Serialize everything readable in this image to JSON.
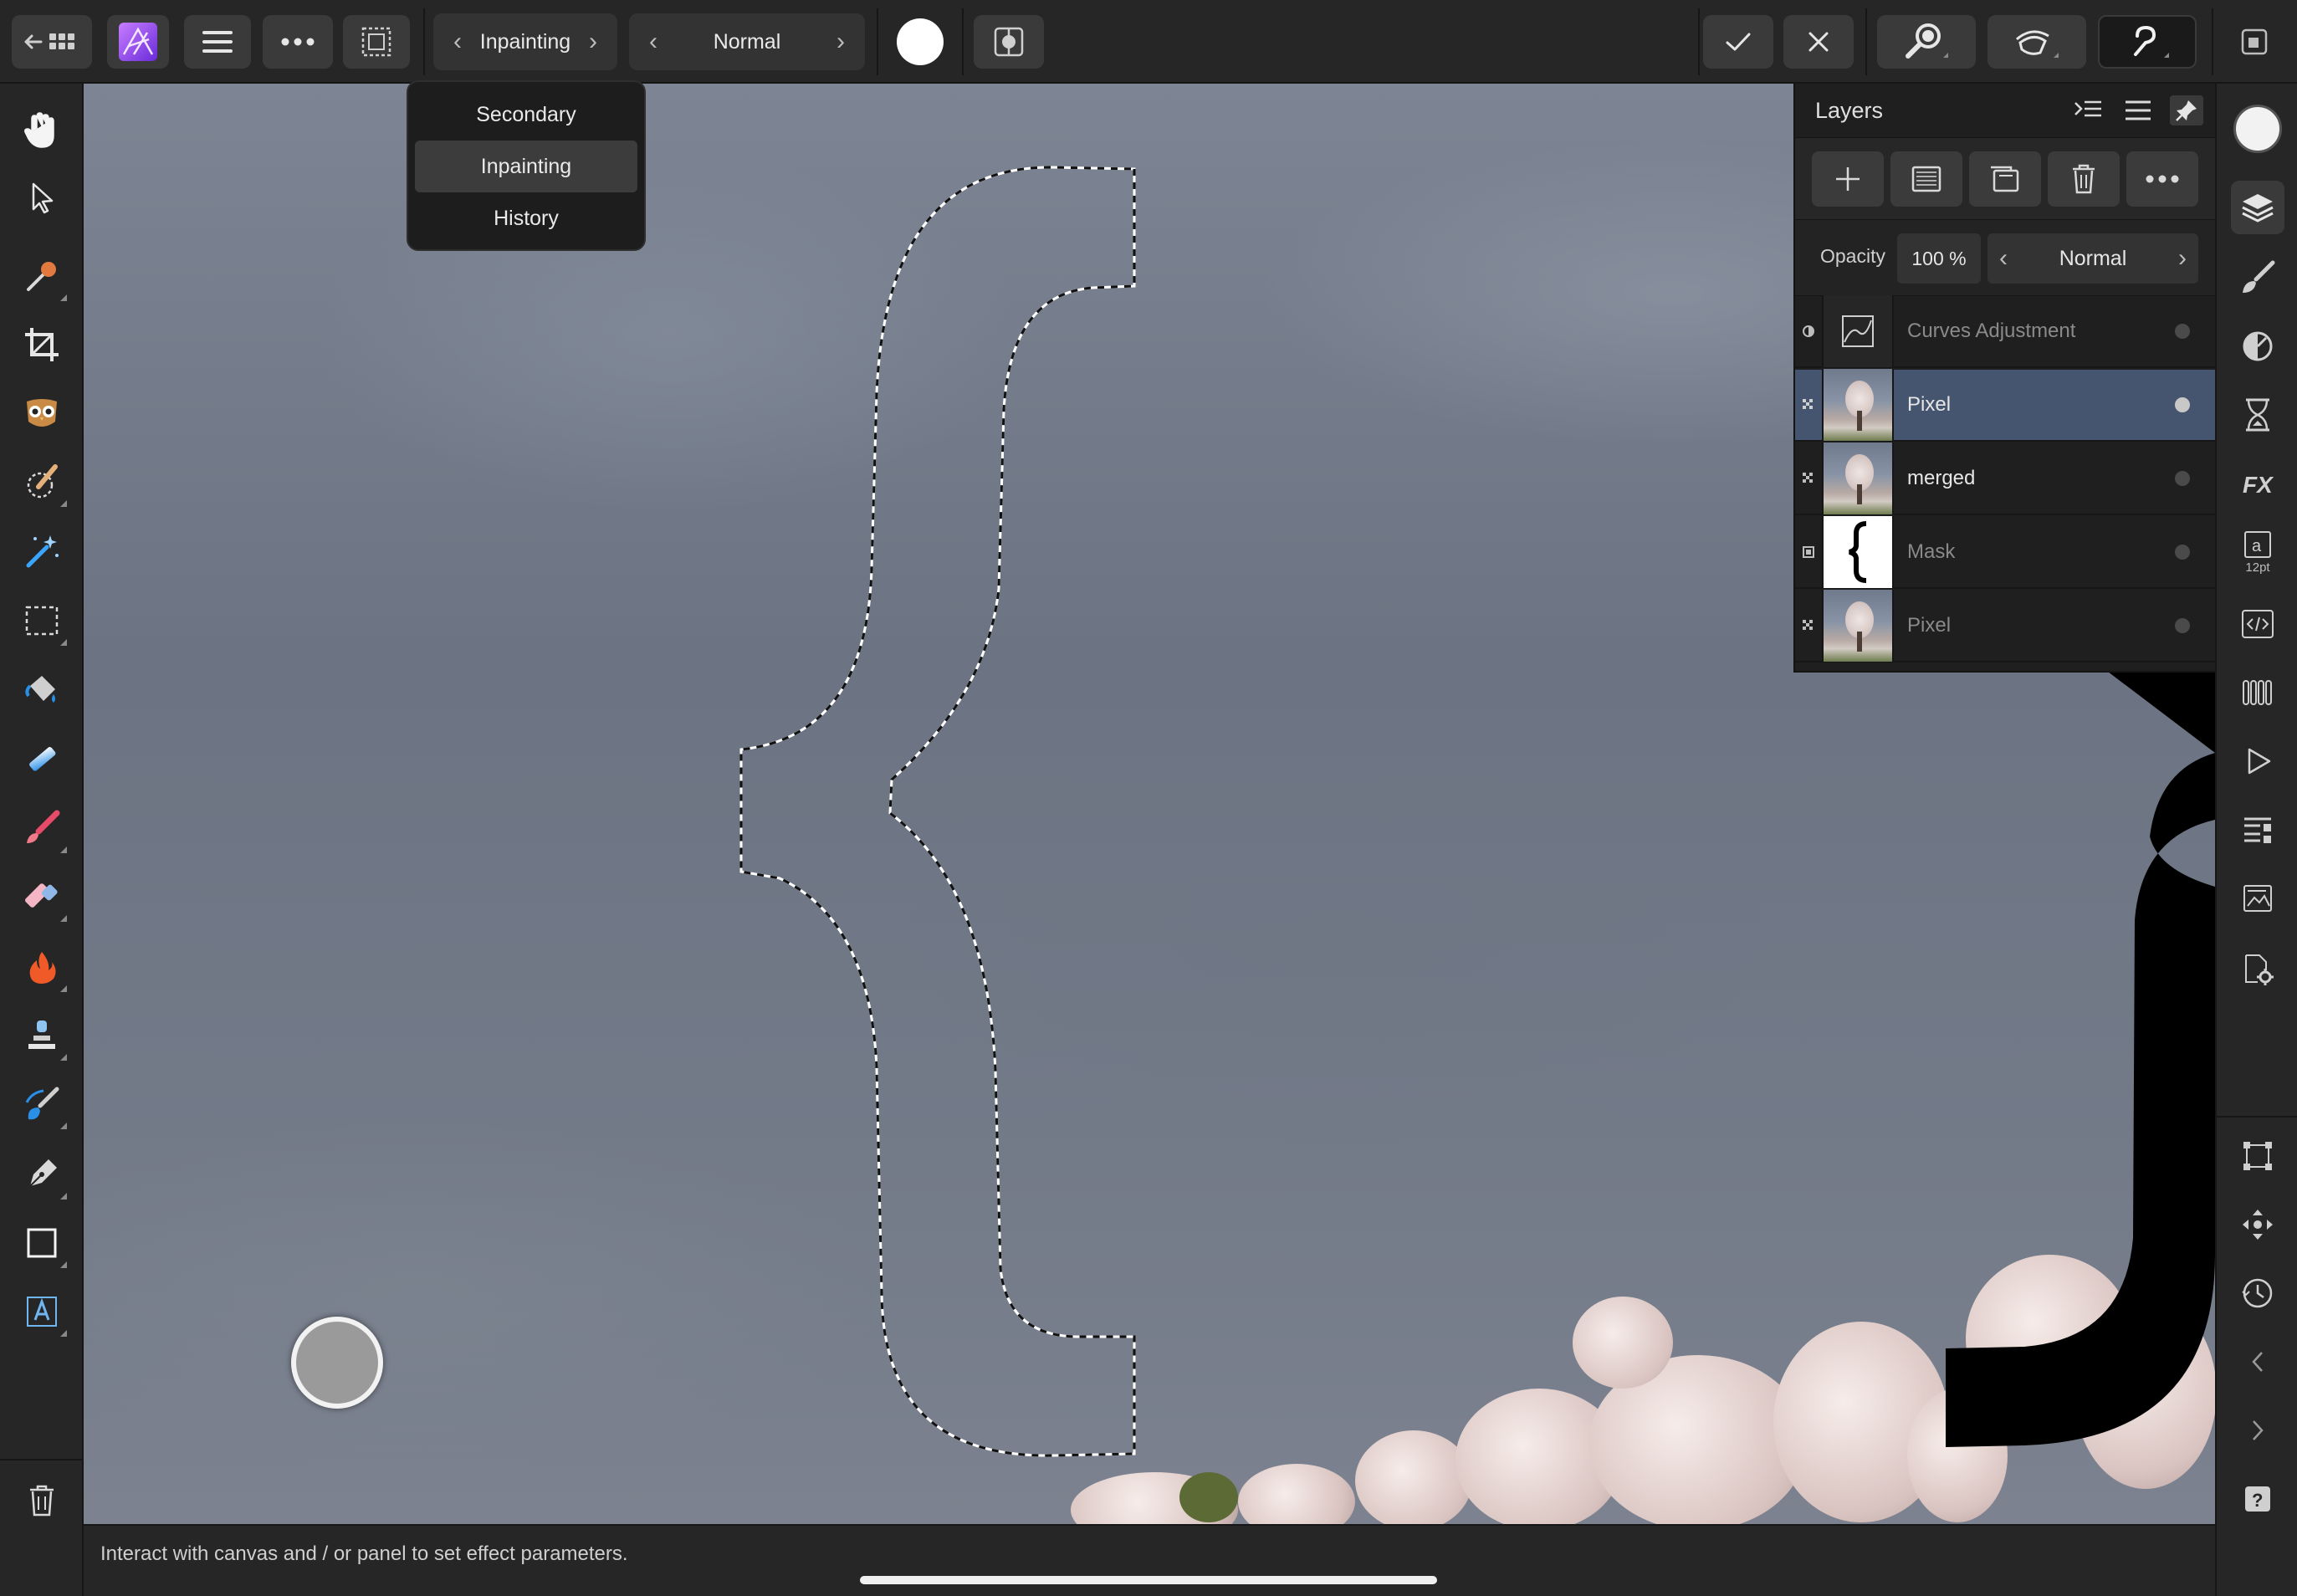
{
  "toolbar": {
    "persona_mode": "Inpainting",
    "blend_mode": "Normal",
    "colors": {
      "accent_brand": "#9b4dff",
      "primary_swatch": "#ffffff"
    }
  },
  "mode_menu": {
    "items": [
      {
        "label": "Secondary",
        "active": false
      },
      {
        "label": "Inpainting",
        "active": true
      },
      {
        "label": "History",
        "active": false
      }
    ]
  },
  "layers_panel": {
    "title": "Layers",
    "opacity_label": "Opacity",
    "opacity_value": "100 %",
    "blend_mode": "Normal",
    "layers": [
      {
        "name": "Curves Adjustment",
        "selected": false,
        "dimmed": true,
        "thumb": "curves"
      },
      {
        "name": "Pixel",
        "selected": true,
        "dimmed": false,
        "thumb": "photo"
      },
      {
        "name": "merged",
        "selected": false,
        "dimmed": false,
        "thumb": "photo"
      },
      {
        "name": "Mask",
        "selected": false,
        "dimmed": true,
        "thumb": "mask"
      },
      {
        "name": "Pixel",
        "selected": false,
        "dimmed": true,
        "thumb": "photo"
      }
    ],
    "selected_color": "#46556f"
  },
  "right_studio": {
    "text_tool_size": "12pt"
  },
  "status": {
    "message": "Interact with canvas and / or panel to set effect parameters."
  }
}
